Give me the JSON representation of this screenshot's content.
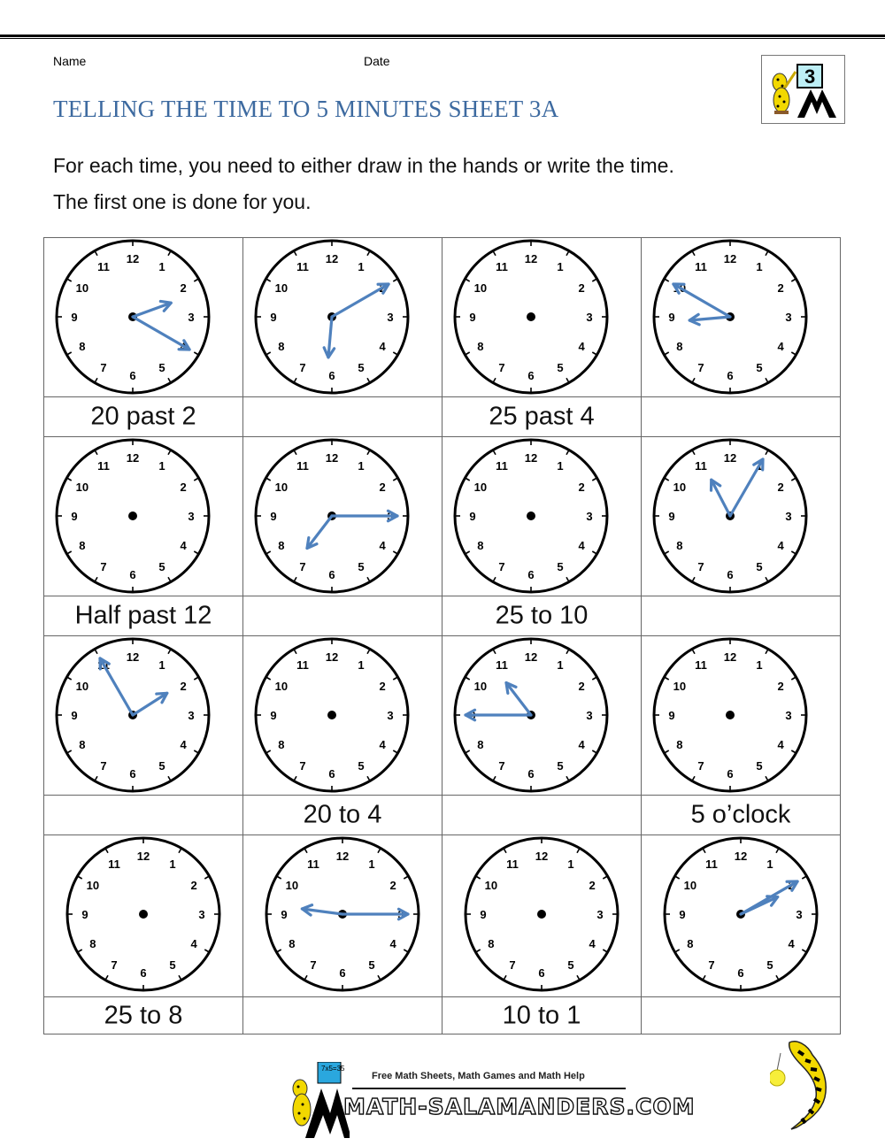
{
  "header": {
    "name_label": "Name",
    "date_label": "Date",
    "title": "TELLING THE TIME TO 5 MINUTES SHEET 3A",
    "grade_badge": "3"
  },
  "instructions": {
    "line1": "For each time, you need to either draw in the hands or write the time.",
    "line2": "The first one is done for you."
  },
  "colors": {
    "title": "#3d6aa0",
    "hands": "#4f81bd",
    "clock_outline": "#000000",
    "grid": "#666666"
  },
  "clock_numbers": [
    "12",
    "1",
    "2",
    "3",
    "4",
    "5",
    "6",
    "7",
    "8",
    "9",
    "10",
    "11"
  ],
  "rows": [
    {
      "clocks": [
        {
          "hands": true,
          "hour": 2,
          "minute": 20,
          "label": "20 past 2"
        },
        {
          "hands": true,
          "hour": 6,
          "minute": 10,
          "label": ""
        },
        {
          "hands": false,
          "label": "25 past 4"
        },
        {
          "hands": true,
          "hour": 8,
          "minute": 50,
          "label": ""
        }
      ]
    },
    {
      "clocks": [
        {
          "hands": false,
          "label": "Half past 12"
        },
        {
          "hands": true,
          "hour": 7,
          "minute": 15,
          "label": ""
        },
        {
          "hands": false,
          "label": "25 to 10"
        },
        {
          "hands": true,
          "hour": 11,
          "minute": 5,
          "label": ""
        }
      ]
    },
    {
      "clocks": [
        {
          "hands": true,
          "hour": 1,
          "minute": 55,
          "label": ""
        },
        {
          "hands": false,
          "label": "20 to 4"
        },
        {
          "hands": true,
          "hour": 10,
          "minute": 45,
          "label": ""
        },
        {
          "hands": false,
          "label": "5 o’clock"
        }
      ]
    },
    {
      "clocks": [
        {
          "hands": false,
          "label": "25 to 8"
        },
        {
          "hands": true,
          "hour": 9,
          "minute": 15,
          "label": ""
        },
        {
          "hands": false,
          "label": "10 to 1"
        },
        {
          "hands": true,
          "hour": 2,
          "minute": 10,
          "label": ""
        }
      ]
    }
  ],
  "footer": {
    "tagline": "Free Math Sheets, Math Games and Math Help",
    "site": "MATH-SALAMANDERS.COM",
    "board_text": "7x5=35"
  },
  "icons": {
    "logo": "salamander-teacher-logo-icon",
    "mascot": "salamander-with-clock-icon"
  }
}
